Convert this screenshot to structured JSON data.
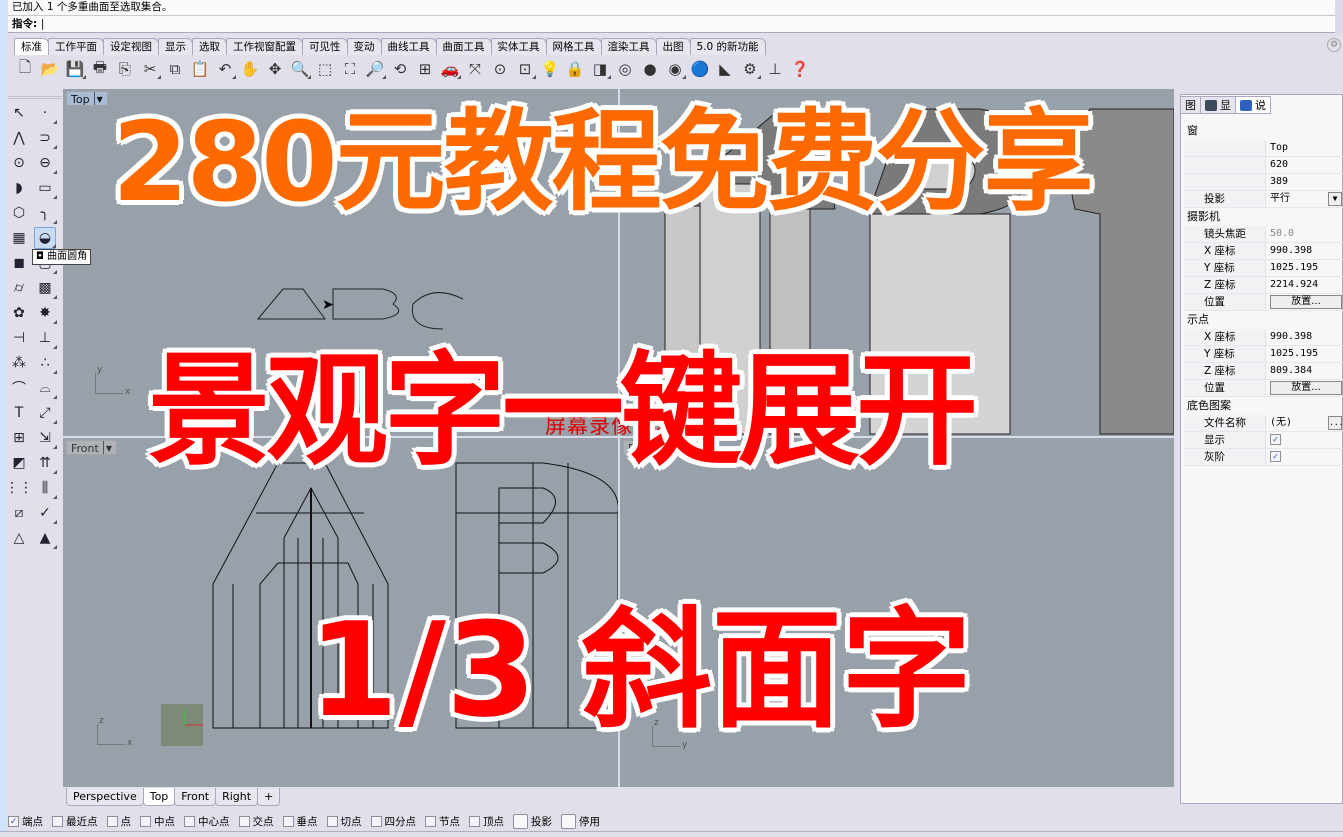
{
  "command": {
    "history": "已加入 1 个多重曲面至选取集合。",
    "prompt_label": "指令:",
    "input_value": "|"
  },
  "tabs": [
    "标准",
    "工作平面",
    "设定视图",
    "显示",
    "选取",
    "工作视窗配置",
    "可见性",
    "变动",
    "曲线工具",
    "曲面工具",
    "实体工具",
    "网格工具",
    "渲染工具",
    "出图",
    "5.0 的新功能"
  ],
  "active_tab": "标准",
  "toolbar_icons": [
    {
      "name": "new-file-icon",
      "glyph": "🗋"
    },
    {
      "name": "open-folder-icon",
      "glyph": "📂"
    },
    {
      "name": "save-icon",
      "glyph": "💾"
    },
    {
      "name": "print-icon",
      "glyph": "🖶"
    },
    {
      "name": "import-icon",
      "glyph": "⎘"
    },
    {
      "name": "cut-icon",
      "glyph": "✂"
    },
    {
      "name": "copy-icon",
      "glyph": "⧉"
    },
    {
      "name": "paste-icon",
      "glyph": "📋"
    },
    {
      "name": "undo-icon",
      "glyph": "↶"
    },
    {
      "name": "pan-hand-icon",
      "glyph": "✋"
    },
    {
      "name": "rotate-view-icon",
      "glyph": "✥"
    },
    {
      "name": "zoom-dynamic-icon",
      "glyph": "🔍"
    },
    {
      "name": "zoom-window-icon",
      "glyph": "⬚"
    },
    {
      "name": "zoom-extents-icon",
      "glyph": "⛶"
    },
    {
      "name": "zoom-selected-icon",
      "glyph": "🔎"
    },
    {
      "name": "undo-view-icon",
      "glyph": "⟲"
    },
    {
      "name": "four-viewports-icon",
      "glyph": "⊞"
    },
    {
      "name": "car-icon",
      "glyph": "🚗"
    },
    {
      "name": "cplane-icon",
      "glyph": "⤧"
    },
    {
      "name": "circle-point-icon",
      "glyph": "⊙"
    },
    {
      "name": "object-snap-icon",
      "glyph": "⊡"
    },
    {
      "name": "light-bulb-icon",
      "glyph": "💡"
    },
    {
      "name": "lock-icon",
      "glyph": "🔒"
    },
    {
      "name": "layer-icon",
      "glyph": "◨"
    },
    {
      "name": "color-wheel-icon",
      "glyph": "◎"
    },
    {
      "name": "shaded-sphere-icon",
      "glyph": "●"
    },
    {
      "name": "rendered-sphere-icon",
      "glyph": "◉"
    },
    {
      "name": "render-icon",
      "glyph": "🔵"
    },
    {
      "name": "material-icon",
      "glyph": "◣"
    },
    {
      "name": "options-gear-icon",
      "glyph": "⚙"
    },
    {
      "name": "dimension-icon",
      "glyph": "⊥"
    },
    {
      "name": "help-icon",
      "glyph": "❓"
    }
  ],
  "side_tools": [
    {
      "name": "select-arrow-icon",
      "glyph": "↖"
    },
    {
      "name": "point-icon",
      "glyph": "·"
    },
    {
      "name": "polyline-icon",
      "glyph": "⋀"
    },
    {
      "name": "curve-icon",
      "glyph": "⊃"
    },
    {
      "name": "circle-icon",
      "glyph": "⊙"
    },
    {
      "name": "ellipse-icon",
      "glyph": "⊖"
    },
    {
      "name": "arc-icon",
      "glyph": "◗"
    },
    {
      "name": "rectangle-icon",
      "glyph": "▭"
    },
    {
      "name": "polygon-icon",
      "glyph": "⬡"
    },
    {
      "name": "fillet-curve-icon",
      "glyph": "╮"
    },
    {
      "name": "surface-icon",
      "glyph": "▦"
    },
    {
      "name": "fillet-surface-icon",
      "glyph": "◒"
    },
    {
      "name": "box-icon",
      "glyph": "◼"
    },
    {
      "name": "extrude-icon",
      "glyph": "▢"
    },
    {
      "name": "cylinder-icon",
      "glyph": "⌭"
    },
    {
      "name": "mesh-icon",
      "glyph": "▩"
    },
    {
      "name": "boolean-icon",
      "glyph": "✿"
    },
    {
      "name": "explode-icon",
      "glyph": "✸"
    },
    {
      "name": "trim-icon",
      "glyph": "⊣"
    },
    {
      "name": "split-icon",
      "glyph": "⊥"
    },
    {
      "name": "group-icon",
      "glyph": "⁂"
    },
    {
      "name": "ungroup-icon",
      "glyph": "∴"
    },
    {
      "name": "offset-icon",
      "glyph": "⌒"
    },
    {
      "name": "offset-surface-icon",
      "glyph": "⌓"
    },
    {
      "name": "text-icon",
      "glyph": "T"
    },
    {
      "name": "scale-icon",
      "glyph": "⤢"
    },
    {
      "name": "array-icon",
      "glyph": "⊞"
    },
    {
      "name": "move-icon",
      "glyph": "⇲"
    },
    {
      "name": "solid-edit-icon",
      "glyph": "◩"
    },
    {
      "name": "extrude-up-icon",
      "glyph": "⇈"
    },
    {
      "name": "grid-array-icon",
      "glyph": "⋮⋮"
    },
    {
      "name": "analyze-icon",
      "glyph": "⫼"
    },
    {
      "name": "bend-icon",
      "glyph": "⧄"
    },
    {
      "name": "check-icon",
      "glyph": "✓"
    },
    {
      "name": "shape-primitives-icon",
      "glyph": "△"
    },
    {
      "name": "pyramid-icon",
      "glyph": "▲"
    }
  ],
  "tooltip": "曲面圆角",
  "viewports": {
    "top": {
      "label": "Top",
      "axis": [
        "y",
        "x"
      ]
    },
    "perspective": {
      "label": "Perspective"
    },
    "front": {
      "label": "Front",
      "axis": [
        "z",
        "x"
      ]
    },
    "right": {
      "label": "Right",
      "axis": [
        "z",
        "y"
      ]
    }
  },
  "viewport_tabs": [
    "Perspective",
    "Top",
    "Front",
    "Right",
    "+"
  ],
  "active_viewport_tab": "Top",
  "osnaps": [
    {
      "label": "端点",
      "checked": true
    },
    {
      "label": "最近点",
      "checked": false
    },
    {
      "label": "点",
      "checked": false
    },
    {
      "label": "中点",
      "checked": false
    },
    {
      "label": "中心点",
      "checked": false
    },
    {
      "label": "交点",
      "checked": false
    },
    {
      "label": "垂点",
      "checked": false
    },
    {
      "label": "切点",
      "checked": false
    },
    {
      "label": "四分点",
      "checked": false
    },
    {
      "label": "节点",
      "checked": false
    },
    {
      "label": "顶点",
      "checked": false
    },
    {
      "label": "投影",
      "checked": false
    },
    {
      "label": "停用",
      "checked": false
    }
  ],
  "properties": {
    "tabs": [
      {
        "label": "图",
        "icon": "layer-tab-icon"
      },
      {
        "label": "显",
        "icon": "display-tab-icon"
      },
      {
        "label": "说",
        "icon": "help-tab-icon"
      }
    ],
    "section_viewport": "窗",
    "rows_viewport": [
      {
        "key": "",
        "value": "Top"
      },
      {
        "key": "",
        "value": "620"
      },
      {
        "key": "",
        "value": "389"
      },
      {
        "key": "投影",
        "value": "平行"
      }
    ],
    "section_camera": "摄影机",
    "rows_camera": [
      {
        "key": "镜头焦距",
        "value": "50.0",
        "disabled": true
      },
      {
        "key": "X 座标",
        "value": "990.398"
      },
      {
        "key": "Y 座标",
        "value": "1025.195"
      },
      {
        "key": "Z 座标",
        "value": "2214.924"
      },
      {
        "key": "位置",
        "button": "放置..."
      }
    ],
    "section_target": "示点",
    "rows_target": [
      {
        "key": "X 座标",
        "value": "990.398"
      },
      {
        "key": "Y 座标",
        "value": "1025.195"
      },
      {
        "key": "Z 座标",
        "value": "809.384"
      },
      {
        "key": "位置",
        "button": "放置..."
      }
    ],
    "section_wallpaper": "底色图案",
    "rows_wallpaper": [
      {
        "key": "文件名称",
        "value": "(无)",
        "button": "..."
      },
      {
        "key": "显示",
        "checked": true
      },
      {
        "key": "灰阶",
        "checked": true
      }
    ]
  },
  "overlay": {
    "line1": "280元教程免费分享",
    "line2": "景观字一键展开",
    "line3": "1/3 斜面字",
    "watermark": "屏幕录像专家 未"
  },
  "colors": {
    "overlay_orange": "#ff6a00",
    "overlay_red": "#ff0000",
    "viewport_bg": "#98a0a9",
    "active_viewport_label": "#a8bcd6"
  }
}
